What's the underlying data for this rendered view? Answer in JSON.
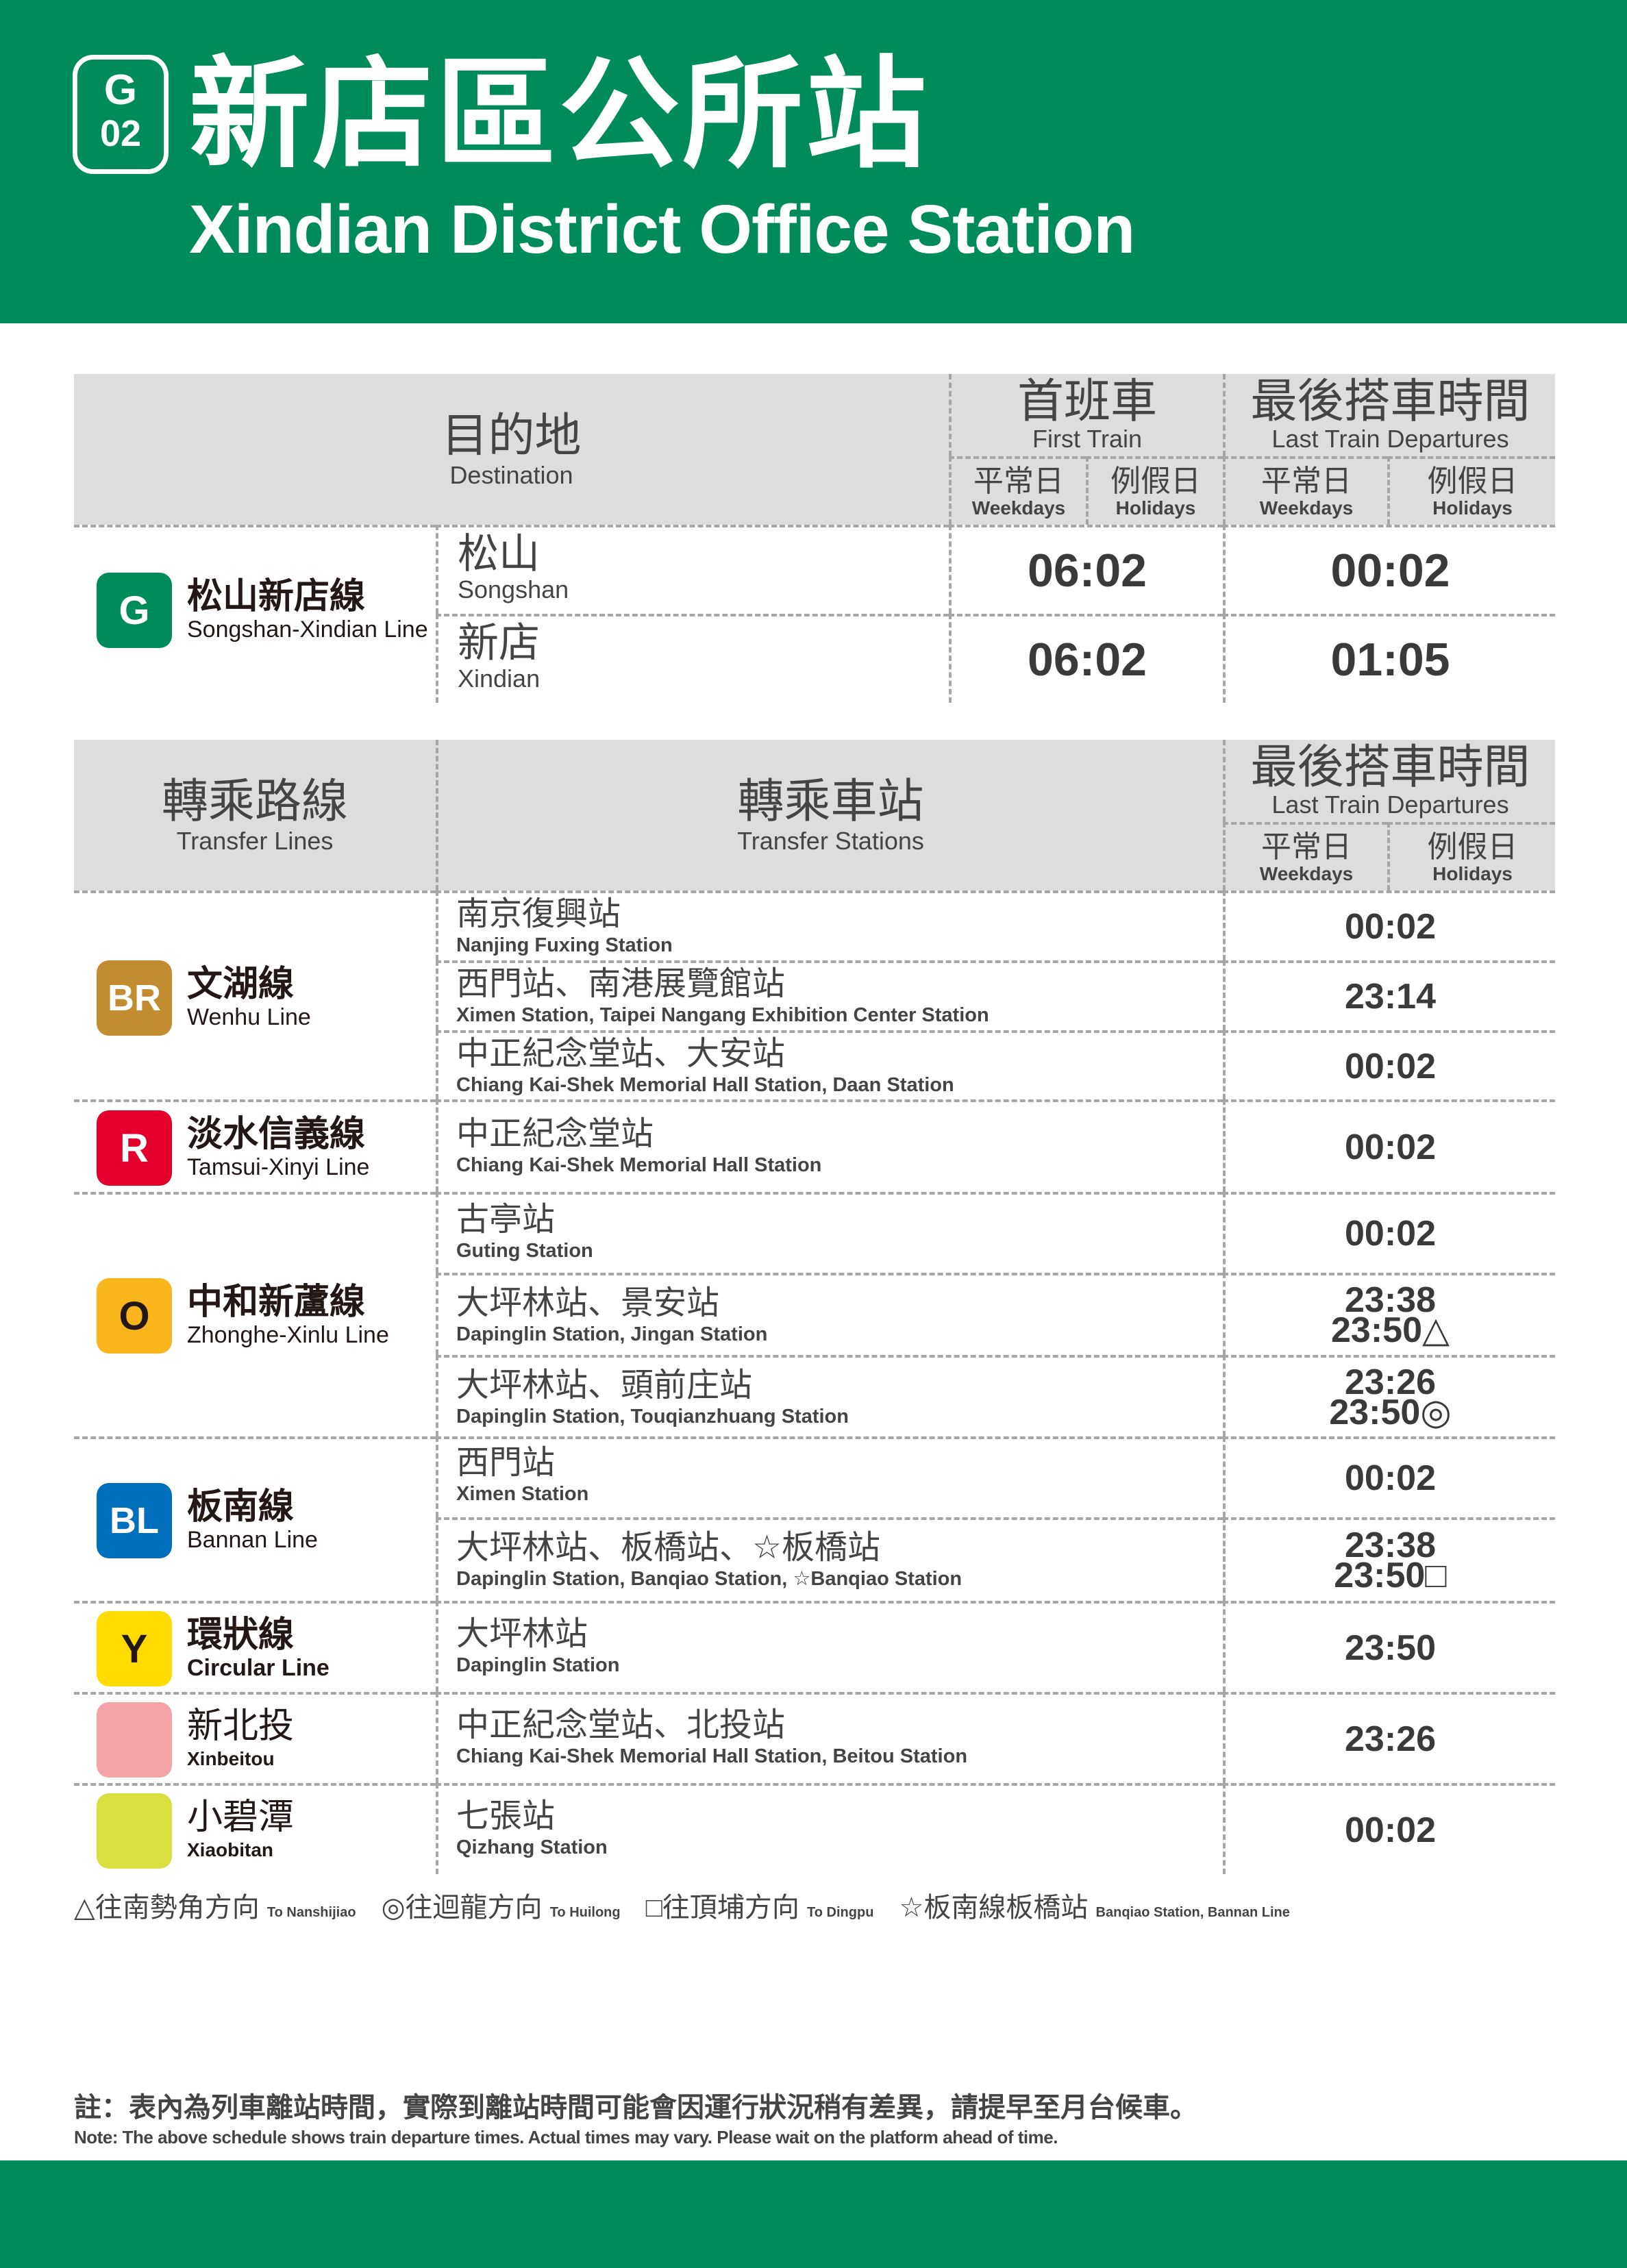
{
  "header": {
    "badge_line": "G",
    "badge_num": "02",
    "title_zh": "新店區公所站",
    "title_en": "Xindian District Office Station"
  },
  "first_table": {
    "destination_zh": "目的地",
    "destination_en": "Destination",
    "first_train_zh": "首班車",
    "first_train_en": "First Train",
    "last_train_zh": "最後搭車時間",
    "last_train_en": "Last Train Departures",
    "weekdays_zh": "平常日",
    "weekdays_en": "Weekdays",
    "holidays_zh": "例假日",
    "holidays_en": "Holidays",
    "line": {
      "code": "G",
      "name_zh": "松山新店線",
      "name_en": "Songshan-Xindian Line",
      "color": "#008c5a"
    },
    "rows": [
      {
        "dest_zh": "松山",
        "dest_en": "Songshan",
        "first": "06:02",
        "last": "00:02"
      },
      {
        "dest_zh": "新店",
        "dest_en": "Xindian",
        "first": "06:02",
        "last": "01:05"
      }
    ]
  },
  "transfer_table": {
    "lines_zh": "轉乘路線",
    "lines_en": "Transfer Lines",
    "stations_zh": "轉乘車站",
    "stations_en": "Transfer Stations",
    "last_zh": "最後搭車時間",
    "last_en": "Last Train Departures",
    "weekdays_zh": "平常日",
    "weekdays_en": "Weekdays",
    "holidays_zh": "例假日",
    "holidays_en": "Holidays",
    "lines": [
      {
        "code": "BR",
        "name_zh": "文湖線",
        "name_en": "Wenhu Line",
        "color": "#c48c31"
      },
      {
        "code": "R",
        "name_zh": "淡水信義線",
        "name_en": "Tamsui-Xinyi Line",
        "color": "#e3002c"
      },
      {
        "code": "O",
        "name_zh": "中和新蘆線",
        "name_en": "Zhonghe-Xinlu Line",
        "color": "#f8b61c"
      },
      {
        "code": "BL",
        "name_zh": "板南線",
        "name_en": "Bannan Line",
        "color": "#0070bd"
      },
      {
        "code": "Y",
        "name_zh": "環狀線",
        "name_en": "Circular Line",
        "color": "#ffdb00"
      },
      {
        "code": "",
        "name_zh": "新北投",
        "name_en": "Xinbeitou",
        "color": "#f5a2a8"
      },
      {
        "code": "",
        "name_zh": "小碧潭",
        "name_en": "Xiaobitan",
        "color": "#d7e03e"
      }
    ],
    "rows": [
      {
        "st_zh": "南京復興站",
        "st_en": "Nanjing Fuxing Station",
        "t1": "00:02",
        "t2": ""
      },
      {
        "st_zh": "西門站、南港展覽館站",
        "st_en": "Ximen Station, Taipei Nangang Exhibition Center Station",
        "t1": "23:14",
        "t2": ""
      },
      {
        "st_zh": "中正紀念堂站、大安站",
        "st_en": "Chiang Kai-Shek Memorial Hall Station, Daan Station",
        "t1": "00:02",
        "t2": ""
      },
      {
        "st_zh": "中正紀念堂站",
        "st_en": "Chiang Kai-Shek Memorial Hall Station",
        "t1": "00:02",
        "t2": ""
      },
      {
        "st_zh": "古亭站",
        "st_en": "Guting Station",
        "t1": "00:02",
        "t2": ""
      },
      {
        "st_zh": "大坪林站、景安站",
        "st_en": "Dapinglin Station, Jingan Station",
        "t1": "23:38",
        "t2": "23:50△"
      },
      {
        "st_zh": "大坪林站、頭前庄站",
        "st_en": "Dapinglin Station, Touqianzhuang Station",
        "t1": "23:26",
        "t2": "23:50◎"
      },
      {
        "st_zh": "西門站",
        "st_en": "Ximen Station",
        "t1": "00:02",
        "t2": ""
      },
      {
        "st_zh": "大坪林站、板橋站、☆板橋站",
        "st_en": "Dapinglin Station, Banqiao Station, ☆Banqiao Station",
        "t1": "23:38",
        "t2": "23:50□"
      },
      {
        "st_zh": "大坪林站",
        "st_en": "Dapinglin Station",
        "t1": "23:50",
        "t2": ""
      },
      {
        "st_zh": "中正紀念堂站、北投站",
        "st_en": "Chiang Kai-Shek Memorial Hall Station, Beitou Station",
        "t1": "23:26",
        "t2": ""
      },
      {
        "st_zh": "七張站",
        "st_en": "Qizhang Station",
        "t1": "00:02",
        "t2": ""
      }
    ]
  },
  "legend": [
    {
      "zh": "△往南勢角方向",
      "en": "To Nanshijiao"
    },
    {
      "zh": "◎往迴龍方向",
      "en": "To Huilong"
    },
    {
      "zh": "□往頂埔方向",
      "en": "To Dingpu"
    },
    {
      "zh": "☆板南線板橋站",
      "en": "Banqiao Station, Bannan Line"
    }
  ],
  "note": {
    "zh": "註：表內為列車離站時間，實際到離站時間可能會因運行狀況稍有差異，請提早至月台候車。",
    "en": "Note: The above schedule shows train departure times. Actual times may vary. Please wait on the platform ahead of time."
  }
}
